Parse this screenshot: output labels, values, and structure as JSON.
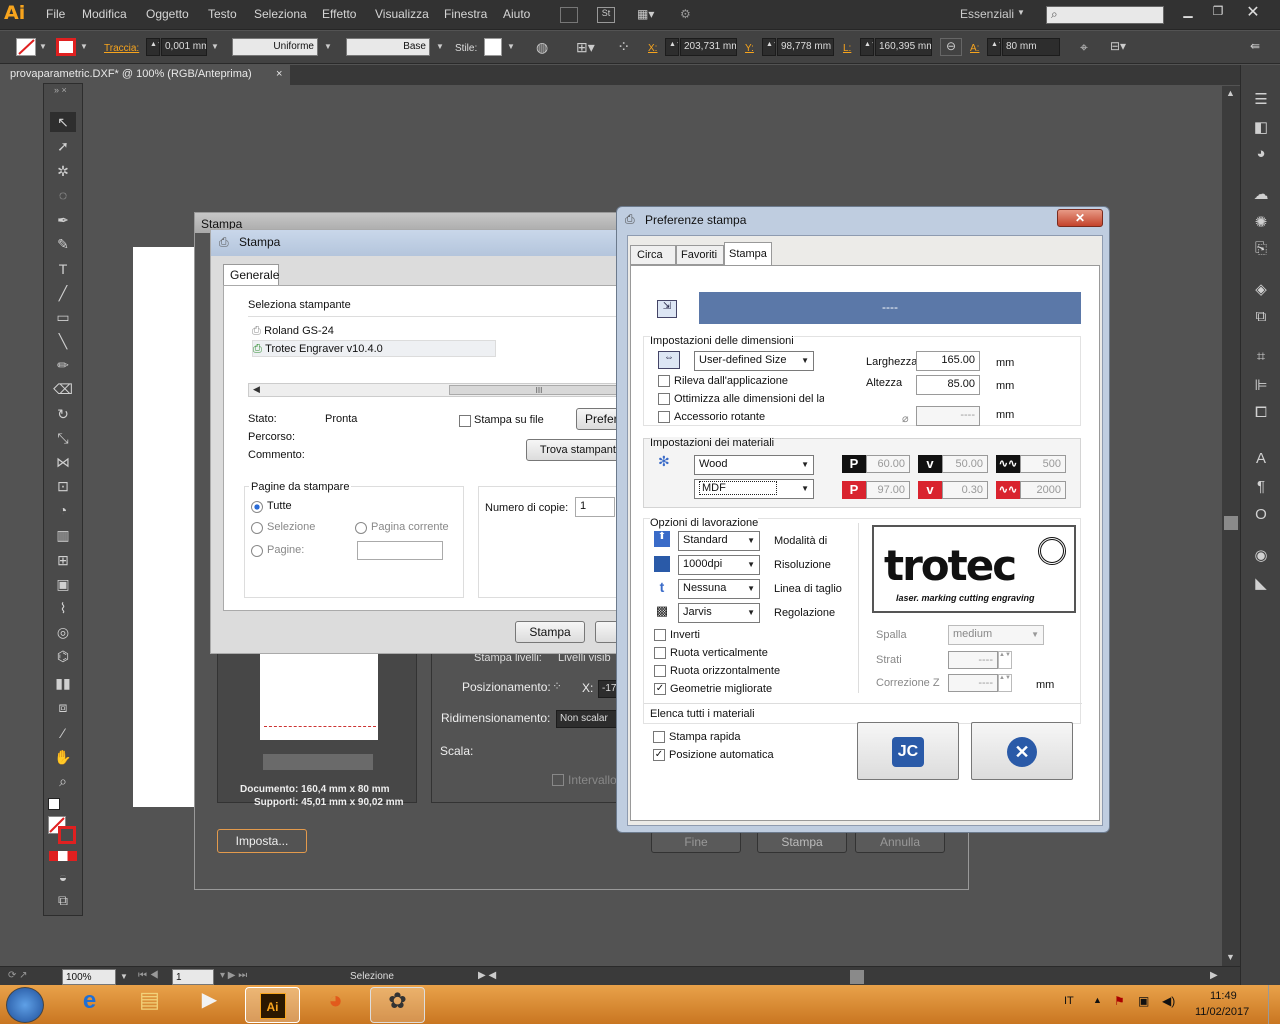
{
  "app": {
    "logo": "Ai",
    "workspace": "Essenziali",
    "search_placeholder": ""
  },
  "menu": [
    "File",
    "Modifica",
    "Oggetto",
    "Testo",
    "Seleziona",
    "Effetto",
    "Visualizza",
    "Finestra",
    "Aiuto"
  ],
  "control": {
    "stroke_label": "Traccia:",
    "stroke_weight": "0,001 mm",
    "profile": "Uniforme",
    "brush": "Base",
    "style_label": "Stile:",
    "x_label": "X:",
    "x": "203,731 mm",
    "y_label": "Y:",
    "y": "98,778 mm",
    "w_label": "L:",
    "w": "160,395 mm",
    "h_label": "A:",
    "h": "80 mm"
  },
  "document_tab": {
    "title": "provaparametric.DXF* @ 100% (RGB/Anteprima)",
    "close": "×"
  },
  "statusbar": {
    "zoom": "100%",
    "page": "1",
    "selection": "Selezione"
  },
  "ai_print_dialog": {
    "title": "Stampa",
    "stampa_livelli": "Stampa livelli:",
    "livelli_value": "Livelli visib",
    "positioning_label": "Posizionamento:",
    "x_label": "X:",
    "x_value": "-17",
    "resize_label": "Ridimensionamento:",
    "resize_value": "Non scalar",
    "scale_label": "Scala:",
    "interval_label": "Intervallo",
    "documento": "Documento: 160,4 mm x 80 mm",
    "supporti": "Supporti: 45,01 mm x 90,02 mm",
    "setup_button": "Imposta...",
    "buttons": [
      "Fine",
      "Stampa",
      "Annulla"
    ]
  },
  "win_print_dialog": {
    "title": "Stampa",
    "tab": "Generale",
    "select_printer_label": "Seleziona stampante",
    "printers": [
      "Roland GS-24",
      "Trotec Engraver v10.4.0"
    ],
    "status_label": "Stato:",
    "status_value": "Pronta",
    "print_to_file": "Stampa su file",
    "preferences_button": "Prefere",
    "path_label": "Percorso:",
    "comment_label": "Commento:",
    "find_printer_button": "Trova stampante",
    "pages_group": "Pagine da stampare",
    "radio_all": "Tutte",
    "radio_selection": "Selezione",
    "radio_current": "Pagina corrente",
    "radio_pages": "Pagine:",
    "copies_label": "Numero di copie:",
    "copies_value": "1",
    "print_button": "Stampa",
    "scroll_marker": "III"
  },
  "pref_dialog": {
    "title": "Preferenze stampa",
    "close": "✕",
    "tabs": [
      "Circa",
      "Favoriti",
      "Stampa"
    ],
    "banner_text": "----",
    "size_group": "Impostazioni delle dimensioni",
    "size_preset": "User-defined Size",
    "width_label": "Larghezza",
    "width_value": "165.00",
    "width_unit": "mm",
    "height_label": "Altezza",
    "height_value": "85.00",
    "height_unit": "mm",
    "diam_value": "----",
    "diam_unit": "mm",
    "chk_detect": "Rileva dall'applicazione",
    "chk_optimize": "Ottimizza alle dimensioni del la",
    "chk_rotary": "Accessorio rotante",
    "material_group": "Impostazioni dei materiali",
    "material": "Wood",
    "material_sub": "MDF",
    "row1": {
      "p": "60.00",
      "v": "50.00",
      "hz": "500"
    },
    "row2": {
      "p": "97.00",
      "v": "0.30",
      "hz": "2000"
    },
    "work_group": "Opzioni di lavorazione",
    "mode": "Standard",
    "mode_label": "Modalità di",
    "dpi": "1000dpi",
    "dpi_label": "Risoluzione",
    "cutline": "Nessuna",
    "cutline_label": "Linea di taglio",
    "dither": "Jarvis",
    "dither_label": "Regolazione",
    "chk_invert": "Inverti",
    "chk_vflip": "Ruota verticalmente",
    "chk_hflip": "Ruota orizzontalmente",
    "chk_geom": "Geometrie migliorate",
    "logo_text": "trotec",
    "logo_tagline": "laser. marking cutting engraving",
    "thickness_label": "Spalla",
    "thickness_value": "medium",
    "layers_label": "Strati",
    "layers_value": "----",
    "zcorr_label": "Correzione Z",
    "zcorr_value": "----",
    "zcorr_unit": "mm",
    "list_all": "Elenca tutti i materiali",
    "chk_fast": "Stampa rapida",
    "chk_autopos": "Posizione automatica"
  },
  "taskbar": {
    "lang": "IT",
    "time": "11:49",
    "date": "11/02/2017"
  },
  "colors": {
    "ai_orange": "#f7a41d",
    "banner_blue": "#5b78a8",
    "trotec_red": "#d9232e"
  }
}
